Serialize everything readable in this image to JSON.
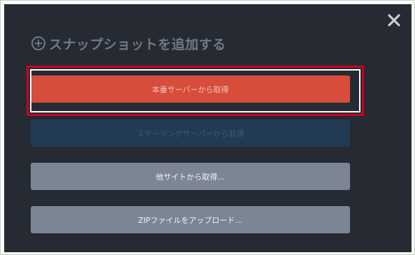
{
  "dialog": {
    "title": "スナップショットを追加する",
    "close_icon": "close-icon",
    "add_icon": "plus-circle-icon"
  },
  "buttons": {
    "production_label": "本番サーバーから取得",
    "staging_label": "ステージングサーバーから取得",
    "other_site_label": "他サイトから取得…",
    "zip_upload_label": "ZIPファイルをアップロード…"
  },
  "colors": {
    "dialog_bg": "#252a33",
    "production": "#d74c3b",
    "staging": "#233a55",
    "secondary": "#7b8594",
    "highlight": "#d0021b"
  }
}
